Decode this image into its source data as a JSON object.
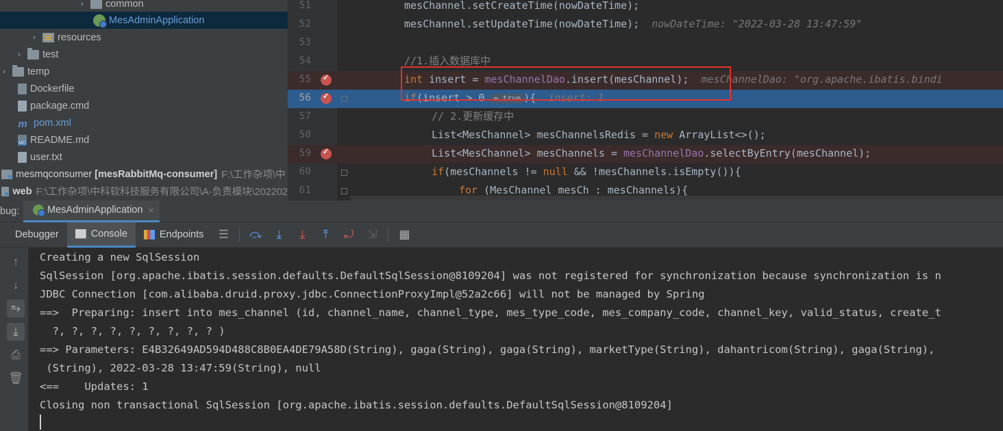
{
  "project_tree": {
    "items": [
      {
        "label": "common"
      },
      {
        "label": "MesAdminApplication"
      },
      {
        "label": "resources"
      },
      {
        "label": "test"
      },
      {
        "label": "temp"
      },
      {
        "label": "Dockerfile"
      },
      {
        "label": "package.cmd"
      },
      {
        "label": "pom.xml"
      },
      {
        "label": "README.md"
      },
      {
        "label": "user.txt"
      }
    ],
    "modules": [
      {
        "name": "mesmqconsumer",
        "tag": "[mesRabbitMq-consumer]",
        "path": "F:\\工作杂项\\中"
      },
      {
        "name": "web",
        "path": "F:\\工作杂项\\中科软科技服务有限公司\\A-负责模块\\202202"
      }
    ]
  },
  "editor": {
    "line_numbers": [
      "51",
      "52",
      "53",
      "54",
      "55",
      "56",
      "57",
      "58",
      "59",
      "60",
      "61"
    ],
    "lines": {
      "l51": {
        "code": "mesChannel.setCreateTime(nowDateTime);"
      },
      "l52": {
        "code": "mesChannel.setUpdateTime(nowDateTime);",
        "inlay": "nowDateTime: \"2022-03-28 13:47:59\""
      },
      "l53": {
        "code": ""
      },
      "l54": {
        "comment": "//1.插入数据库中"
      },
      "l55": {
        "kw": "int",
        "var": " insert = ",
        "field": "mesChannelDao",
        "rest": ".insert(mesChannel);",
        "inlay": "mesChannelDao: \"org.apache.ibatis.bindi"
      },
      "l56": {
        "kw": "if",
        "code": "(insert > 0",
        "badge": "= true",
        "end": "){",
        "inlay": "insert: 1"
      },
      "l57": {
        "comment": "// 2.更新缓存中"
      },
      "l58": {
        "code": "List<MesChannel> mesChannelsRedis = ",
        "kw": "new",
        "rest": " ArrayList<>();"
      },
      "l59": {
        "code": "List<MesChannel> mesChannels = ",
        "field": "mesChannelDao",
        "rest": ".selectByEntry(mesChannel);"
      },
      "l60": {
        "kw": "if",
        "code": "(mesChannels != ",
        "kw2": "null",
        "rest": " && !mesChannels.isEmpty()){"
      },
      "l61": {
        "kw": "for",
        "rest": " (MesChannel mesCh : mesChannels){"
      }
    }
  },
  "debug": {
    "label": "bug:",
    "session_tab": "MesAdminApplication",
    "close_glyph": "×"
  },
  "toolbar": {
    "tabs": [
      "Debugger",
      "Console",
      "Endpoints"
    ]
  },
  "console": {
    "lines": [
      "Creating a new SqlSession",
      "SqlSession [org.apache.ibatis.session.defaults.DefaultSqlSession@8109204] was not registered for synchronization because synchronization is n",
      "JDBC Connection [com.alibaba.druid.proxy.jdbc.ConnectionProxyImpl@52a2c66] will not be managed by Spring",
      "==>  Preparing: insert into mes_channel (id, channel_name, channel_type, mes_type_code, mes_company_code, channel_key, valid_status, create_t",
      "  ?, ?, ?, ?, ?, ?, ?, ?, ? )",
      "==> Parameters: E4B32649AD594D488C8B0EA4DE79A58D(String), gaga(String), gaga(String), marketType(String), dahantricom(String), gaga(String),",
      " (String), 2022-03-28 13:47:59(String), null",
      "<==    Updates: 1",
      "Closing non transactional SqlSession [org.apache.ibatis.session.defaults.DefaultSqlSession@8109204]"
    ]
  },
  "colors": {
    "selection": "#2d5c8f",
    "breakpoint": "#c75450",
    "highlight_box": "#e5312a",
    "accent": "#4a88c7"
  }
}
